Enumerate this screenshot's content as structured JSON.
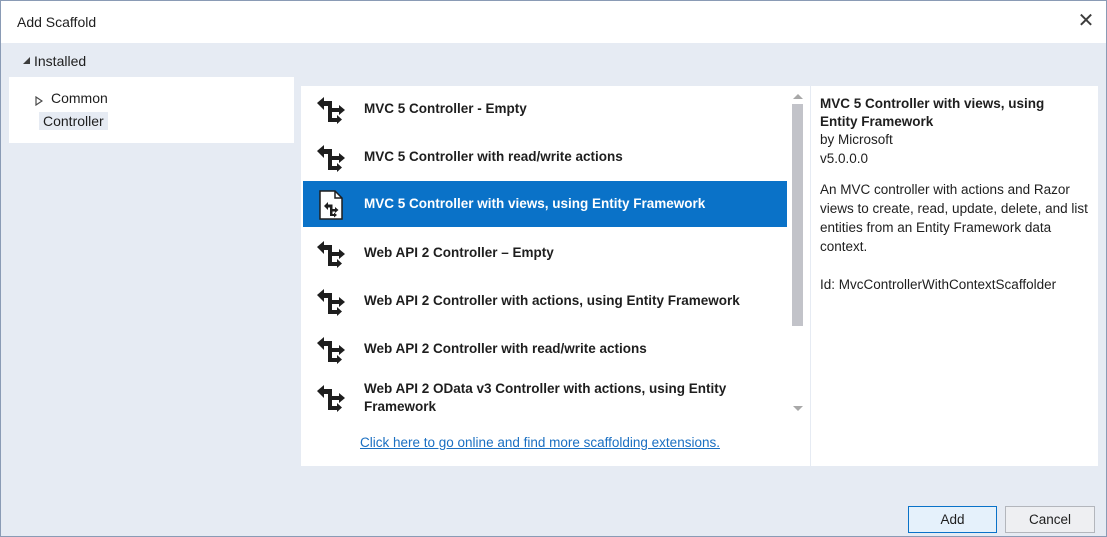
{
  "dialog": {
    "title": "Add Scaffold",
    "close_glyph": "✕"
  },
  "installed": {
    "label": "Installed"
  },
  "tree": {
    "items": [
      {
        "label": "Common"
      },
      {
        "label": "Controller",
        "selected": true
      }
    ]
  },
  "scaffolds": {
    "items": [
      {
        "label": "MVC 5 Controller - Empty",
        "icon": "controller-icon"
      },
      {
        "label": "MVC 5 Controller with read/write actions",
        "icon": "controller-icon"
      },
      {
        "label": "MVC 5 Controller with views, using Entity Framework",
        "icon": "controller-views-icon",
        "selected": true
      },
      {
        "label": "Web API 2 Controller – Empty",
        "icon": "controller-icon"
      },
      {
        "label": "Web API 2 Controller with actions, using Entity Framework",
        "icon": "controller-icon"
      },
      {
        "label": "Web API 2 Controller with read/write actions",
        "icon": "controller-icon"
      },
      {
        "label": "Web API 2 OData v3 Controller with actions, using Entity Framework",
        "icon": "controller-icon"
      }
    ],
    "more_link": "Click here to go online and find more scaffolding extensions."
  },
  "details": {
    "title": "MVC 5 Controller with views, using Entity Framework",
    "author": "by Microsoft",
    "version": "v5.0.0.0",
    "description": "An MVC controller with actions and Razor views to create, read, update, delete, and list entities from an Entity Framework data context.",
    "id": "Id: MvcControllerWithContextScaffolder"
  },
  "buttons": {
    "add": "Add",
    "cancel": "Cancel"
  },
  "colors": {
    "selection": "#0a72c8",
    "link": "#1a6fc2",
    "background": "#e6ebf3"
  }
}
